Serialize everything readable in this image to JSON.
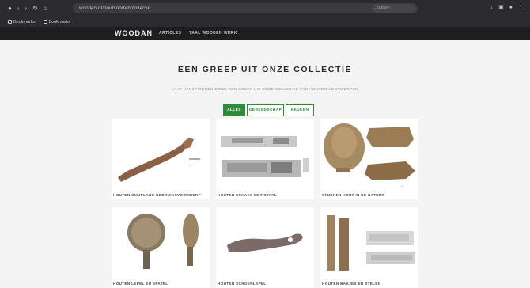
{
  "browser": {
    "url": "wooden.nl/houtsoorten/collectie",
    "search_placeholder": "Zoeken",
    "bookmarks": [
      {
        "label": "Bookmarks"
      },
      {
        "label": "Bookmarks"
      }
    ]
  },
  "site": {
    "logo": "WOODAN",
    "nav": [
      "ARTICLES",
      "TAAL WOODEN WERK"
    ]
  },
  "page": {
    "title": "EEN GREEP UIT ONZE COLLECTIE",
    "subtitle": "LAAT U INSPIREREN DOOR EEN GREEP UIT ONZE COLLECTIE VAN HOUTEN VOORWERPEN"
  },
  "filters": [
    {
      "label": "ALLES",
      "active": true
    },
    {
      "label": "GEREEDSCHAP",
      "active": false
    },
    {
      "label": "KEUKEN",
      "active": false
    }
  ],
  "items": [
    {
      "caption": "HOUTEN SNIJPLANK GEBRUIKSVOORWERP"
    },
    {
      "caption": "HOUTEN SCHAAF MET STAAL"
    },
    {
      "caption": "STUKKEN HOUT IN DE NATUUR"
    },
    {
      "caption": "HOUTEN LEPEL EN SPATEL"
    },
    {
      "caption": "HOUTEN SCHOENLEPEL"
    },
    {
      "caption": "HOUTEN BAKJES EN STELEN"
    }
  ],
  "colors": {
    "accent": "#2f8a3b",
    "header_bg": "#1e1e20",
    "chrome_bg": "#2b2b2e",
    "page_bg": "#f4f4f4"
  }
}
